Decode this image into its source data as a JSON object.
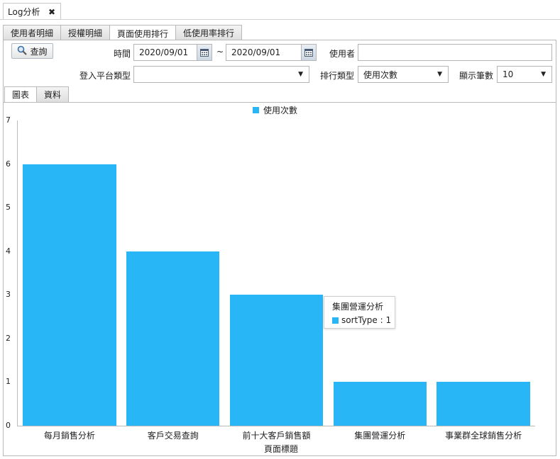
{
  "window_tab": {
    "title": "Log分析",
    "close": "✖"
  },
  "tabs": [
    "使用者明細",
    "授權明細",
    "頁面使用排行",
    "低使用率排行"
  ],
  "active_tab": 2,
  "form": {
    "query_button": "查詢",
    "time_label": "時間",
    "date_from": "2020/09/01",
    "tilde": "~",
    "date_to": "2020/09/01",
    "user_label": "使用者",
    "user_value": "",
    "platform_label": "登入平台類型",
    "platform_value": "",
    "sort_label": "排行類型",
    "sort_value": "使用次數",
    "count_label": "顯示筆數",
    "count_value": "10"
  },
  "view_tabs": [
    "圖表",
    "資料"
  ],
  "active_view_tab": 0,
  "chart_data": {
    "type": "bar",
    "categories": [
      "每月銷售分析",
      "客戶交易查詢",
      "前十大客戶銷售額",
      "集團營運分析",
      "事業群全球銷售分析"
    ],
    "series": [
      {
        "name": "使用次數",
        "values": [
          6,
          4,
          3,
          1,
          1
        ],
        "color": "#29b6f6"
      }
    ],
    "xlabel": "頁面標題",
    "ylabel": "",
    "ylim": [
      0,
      7
    ],
    "yticks": [
      0,
      1,
      2,
      3,
      4,
      5,
      6,
      7
    ],
    "legend": "top-center",
    "grid": false,
    "tooltip": {
      "title": "集團營運分析",
      "text": "sortType : 1"
    }
  }
}
